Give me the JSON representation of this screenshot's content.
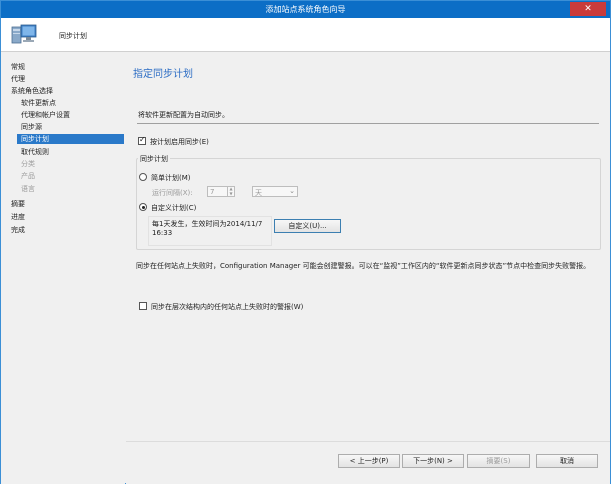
{
  "window": {
    "title": "添加站点系统角色向导",
    "close_glyph": "✕"
  },
  "header": {
    "subtitle": "同步计划",
    "icon": "computer-monitor-icon"
  },
  "sidebar": {
    "items": [
      {
        "label": "常规"
      },
      {
        "label": "代理"
      },
      {
        "label": "系统角色选择"
      },
      {
        "label": "软件更新点"
      },
      {
        "label": "代理和帐户设置"
      },
      {
        "label": "同步源"
      },
      {
        "label": "同步计划"
      },
      {
        "label": "取代规则"
      },
      {
        "label": "分类"
      },
      {
        "label": "产品"
      },
      {
        "label": "语言"
      },
      {
        "label": "摘要"
      },
      {
        "label": "进度"
      },
      {
        "label": "完成"
      }
    ]
  },
  "main": {
    "title": "指定同步计划",
    "description": "将软件更新配置为自动同步。",
    "enable_sync_label": "按计划启用同步(E)",
    "group_title": "同步计划",
    "simple_label": "简单计划(M)",
    "run_every_label": "运行间隔(X):",
    "run_every_value": "7",
    "run_every_unit": "天",
    "custom_label": "自定义计划(C)",
    "schedule_text": "每1天发生，生效时间为2014/11/7 16:33",
    "customize_button": "自定义(U)...",
    "note": "同步在任何站点上失败时，Configuration Manager 可能会创建警报。可以在“监视”工作区内的“软件更新点同步状态”节点中检查同步失败警报。",
    "alert_label": "同步在层次结构内的任何站点上失败时的警报(W)"
  },
  "footer": {
    "prev": "< 上一步(P)",
    "next": "下一步(N) >",
    "summary": "摘要(S)",
    "cancel": "取消"
  },
  "colors": {
    "title_bar": "#0c6ec6",
    "accent_text": "#2b6cc4",
    "nav_selected": "#2a79c9"
  }
}
